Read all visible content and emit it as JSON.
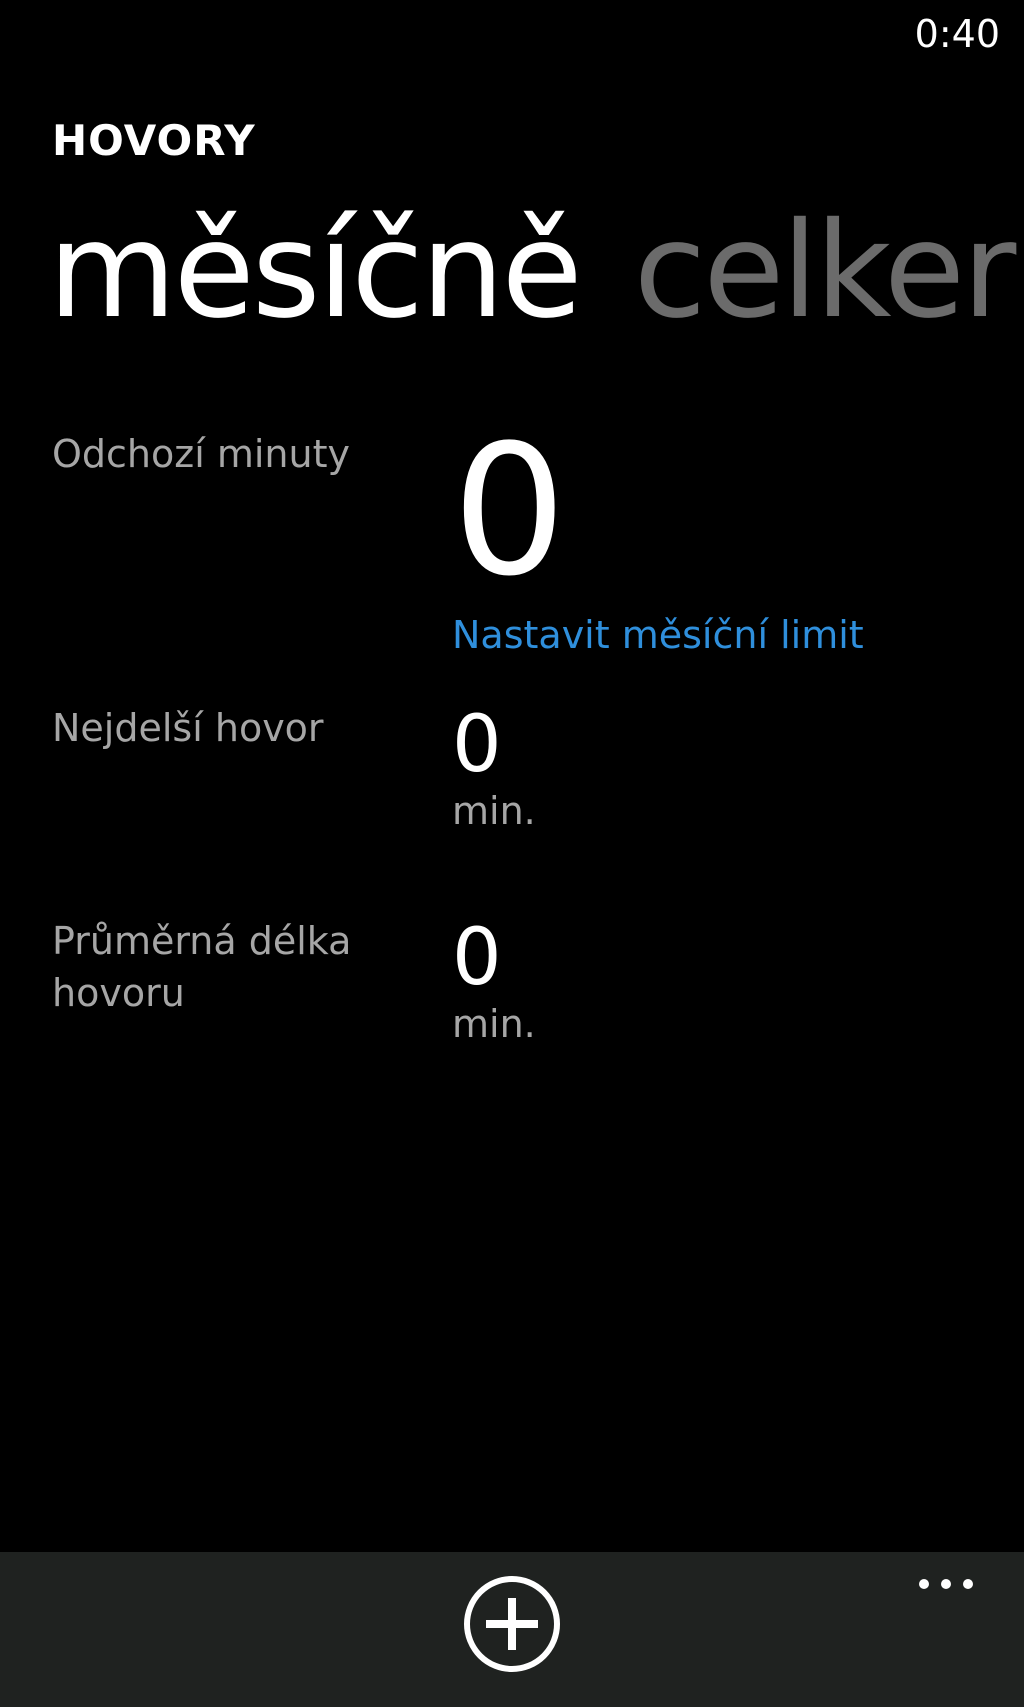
{
  "status_bar": {
    "time": "0:40"
  },
  "header": {
    "app_title": "HOVORY"
  },
  "pivot": {
    "tabs": [
      {
        "label": "měsíčně",
        "active": true
      },
      {
        "label": "celker",
        "active": false
      }
    ]
  },
  "stats": {
    "outgoing": {
      "label": "Odchozí minuty",
      "value": "0",
      "link_label": "Nastavit měsíční limit"
    },
    "longest_call": {
      "label": "Nejdelší hovor",
      "value": "0",
      "unit": "min."
    },
    "average_call": {
      "label": "Průměrná délka hovoru",
      "value": "0",
      "unit": "min."
    }
  },
  "app_bar": {
    "buttons": [
      {
        "icon": "add-circle-icon"
      },
      {
        "icon": "more-dots-icon"
      }
    ]
  },
  "colors": {
    "background": "#000000",
    "accent": "#2f8fdc",
    "secondary_text": "#a6a6a6",
    "inactive_tab": "#6b6b6b",
    "app_bar": "#1f2220"
  }
}
